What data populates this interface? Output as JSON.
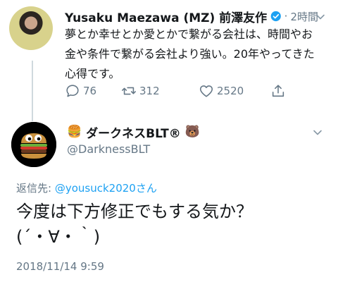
{
  "parent_tweet": {
    "name": "Yusaku Maezawa (MZ) 前澤友作",
    "separator": "·",
    "time": "2時間",
    "text": "夢とか幸せとか愛とかで繋がる会社は、時間やお金や条件で繋がる会社より強い。20年やってきた心得です。",
    "reply_count": "76",
    "retweet_count": "312",
    "like_count": "2520",
    "icons": [
      "verified-badge-icon",
      "reply-icon",
      "retweet-icon",
      "like-icon",
      "share-icon",
      "chevron-down-icon"
    ],
    "colors": {
      "verified": "#1da1f2",
      "meta": "#657786"
    }
  },
  "main_tweet": {
    "name_prefix": "🍔",
    "name": "ダークネスBLT®",
    "name_suffix": "🐻",
    "handle": "@DarknessBLT",
    "reply_label": "返信先: ",
    "reply_to": "@yousuck2020さん",
    "text_line1": "今度は下方修正でもする気か？",
    "text_line2": "(´・∀・｀)",
    "timestamp": "2018/11/14 9:59",
    "icons": [
      "burger-avatar-icon",
      "chevron-down-icon"
    ],
    "colors": {
      "link": "#1da1f2"
    }
  }
}
